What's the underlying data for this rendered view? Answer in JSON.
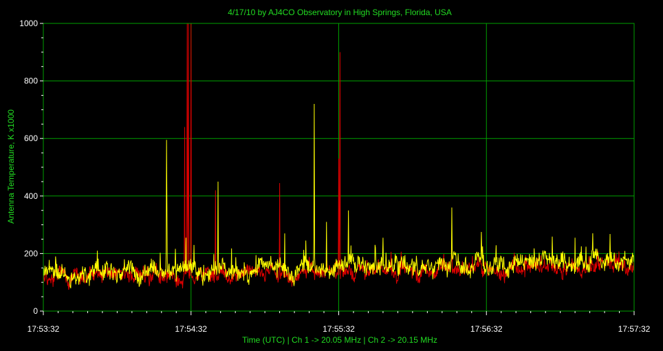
{
  "chart_data": {
    "type": "line",
    "title": "4/17/10  by  AJ4CO Observatory  in  High Springs, Florida, USA",
    "xlabel": "Time (UTC)  |  Ch 1 -> 20.05 MHz  |  Ch 2 -> 20.15 MHz",
    "ylabel": "Antenna Temperature, K x1000",
    "ylim": [
      0,
      1000
    ],
    "yticks": [
      0,
      200,
      400,
      600,
      800,
      1000
    ],
    "yticks_labels": [
      "0",
      "200",
      "400",
      "600",
      "800",
      "1000"
    ],
    "xlim_seconds": [
      0,
      240
    ],
    "xtick_labels": [
      "17:53:32",
      "17:54:32",
      "17:55:32",
      "17:56:32",
      "17:57:32"
    ],
    "grid": true,
    "colors": {
      "background": "#000000",
      "grid": "#00a000",
      "text": "#22dd22",
      "tick_labels": "#ffffff",
      "frame": "#00a000"
    },
    "series": [
      {
        "color": "#dd0000",
        "baseline_start": 118,
        "baseline_end": 160,
        "spikes": [
          {
            "t": 57.5,
            "value": 640
          },
          {
            "t": 58.5,
            "value": 1000
          },
          {
            "t": 59.0,
            "value": 1000
          },
          {
            "t": 60.0,
            "value": 1000
          },
          {
            "t": 70.0,
            "value": 420
          },
          {
            "t": 96.0,
            "value": 445
          },
          {
            "t": 120.0,
            "value": 530
          },
          {
            "t": 120.5,
            "value": 900
          },
          {
            "t": 166.0,
            "value": 260
          }
        ]
      },
      {
        "color": "#ffff00",
        "baseline_start": 130,
        "baseline_end": 175,
        "spikes": [
          {
            "t": 5.0,
            "value": 190
          },
          {
            "t": 22.0,
            "value": 210
          },
          {
            "t": 33.0,
            "value": 180
          },
          {
            "t": 50.0,
            "value": 595
          },
          {
            "t": 50.3,
            "value": 350
          },
          {
            "t": 58.0,
            "value": 255
          },
          {
            "t": 71.0,
            "value": 450
          },
          {
            "t": 98.0,
            "value": 270
          },
          {
            "t": 110.0,
            "value": 720
          },
          {
            "t": 115.0,
            "value": 310
          },
          {
            "t": 124.0,
            "value": 350
          },
          {
            "t": 138.0,
            "value": 255
          },
          {
            "t": 166.0,
            "value": 360
          },
          {
            "t": 178.0,
            "value": 275
          },
          {
            "t": 216.0,
            "value": 255
          }
        ]
      }
    ]
  }
}
